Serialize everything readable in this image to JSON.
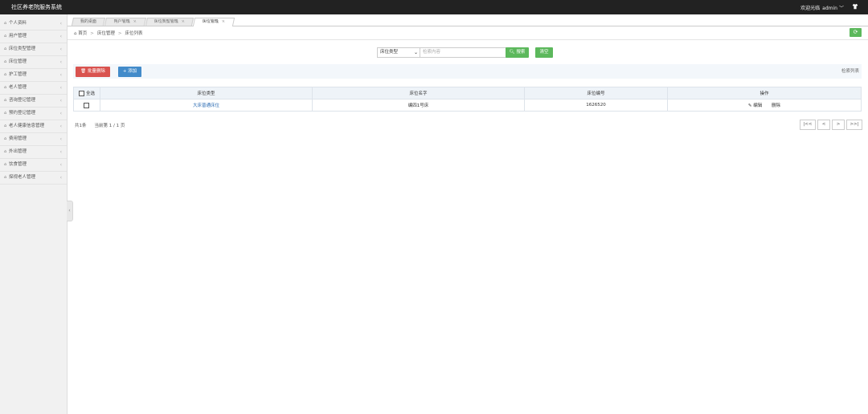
{
  "app": {
    "title": "社区养老院服务系统",
    "welcome": "欢迎光临",
    "username": "admin"
  },
  "sidebar": {
    "items": [
      {
        "label": "个人资料"
      },
      {
        "label": "用户管理"
      },
      {
        "label": "床位类型管理"
      },
      {
        "label": "床位管理"
      },
      {
        "label": "护工管理"
      },
      {
        "label": "老人管理"
      },
      {
        "label": "咨询登记管理"
      },
      {
        "label": "预约登记管理"
      },
      {
        "label": "老人健康信息管理"
      },
      {
        "label": "费用管理"
      },
      {
        "label": "外出管理"
      },
      {
        "label": "饮食管理"
      },
      {
        "label": "探视老人管理"
      }
    ]
  },
  "tabs": [
    {
      "label": "我的桌面"
    },
    {
      "label": "用户管理"
    },
    {
      "label": "床位类型管理"
    },
    {
      "label": "床位管理"
    }
  ],
  "breadcrumb": {
    "home": "首页",
    "level1": "床位管理",
    "level2": "床位列表"
  },
  "search": {
    "select_value": "床位类型",
    "placeholder": "检索内容",
    "search_label": "搜索",
    "reset_label": "清空"
  },
  "actions": {
    "batch_delete_label": "批量删除",
    "add_label": "添加",
    "list_title": "检索列表"
  },
  "table": {
    "select_all_label": "全选",
    "headers": [
      "床位类型",
      "床位名字",
      "床位编号",
      "操作"
    ],
    "rows": [
      {
        "type": "大床普通床位",
        "name": "编四1号床",
        "number": "1626520",
        "edit_label": "编辑",
        "delete_label": "删除"
      }
    ]
  },
  "pagination": {
    "total": "共1条",
    "pages": "当前第 1 / 1 页",
    "first": "|<<",
    "prev": "<",
    "next": ">",
    "last": ">>|"
  },
  "colors": {
    "topbar": "#222222",
    "sidebar": "#f1f1f1",
    "success": "#5cb85c",
    "danger": "#d9534f",
    "primary": "#428bca"
  }
}
